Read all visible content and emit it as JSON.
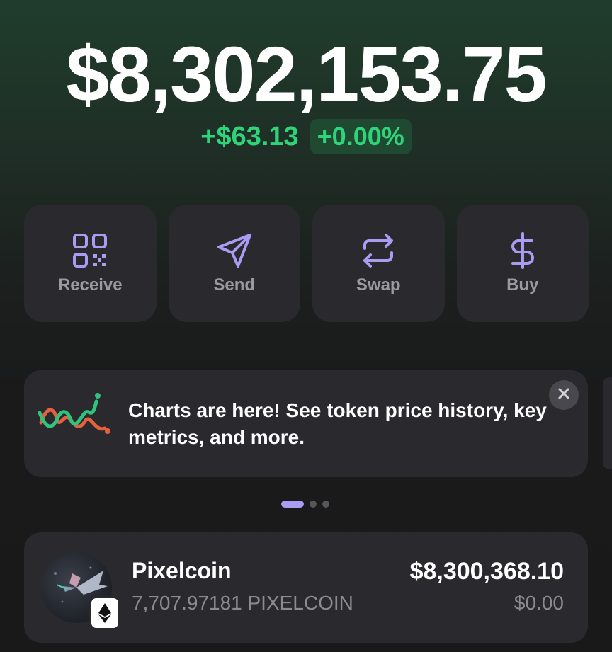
{
  "portfolio": {
    "balance": "$8,302,153.75",
    "change_amount": "+$63.13",
    "change_percent": "+0.00%"
  },
  "actions": [
    {
      "label": "Receive",
      "icon": "qr-code-icon"
    },
    {
      "label": "Send",
      "icon": "send-icon"
    },
    {
      "label": "Swap",
      "icon": "swap-icon"
    },
    {
      "label": "Buy",
      "icon": "dollar-icon"
    }
  ],
  "promo": {
    "text": "Charts are here! See token price history, key metrics, and more.",
    "icon": "chart-squiggle-icon",
    "close_icon": "close-icon"
  },
  "carousel": {
    "total": 3,
    "active": 0
  },
  "tokens": [
    {
      "name": "Pixelcoin",
      "quantity": "7,707.97181 PIXELCOIN",
      "value": "$8,300,368.10",
      "change": "$0.00",
      "chain_icon": "ethereum-icon"
    }
  ],
  "colors": {
    "accent": "#a99cf2",
    "positive": "#2fd37a",
    "card": "#2a2a2e"
  }
}
